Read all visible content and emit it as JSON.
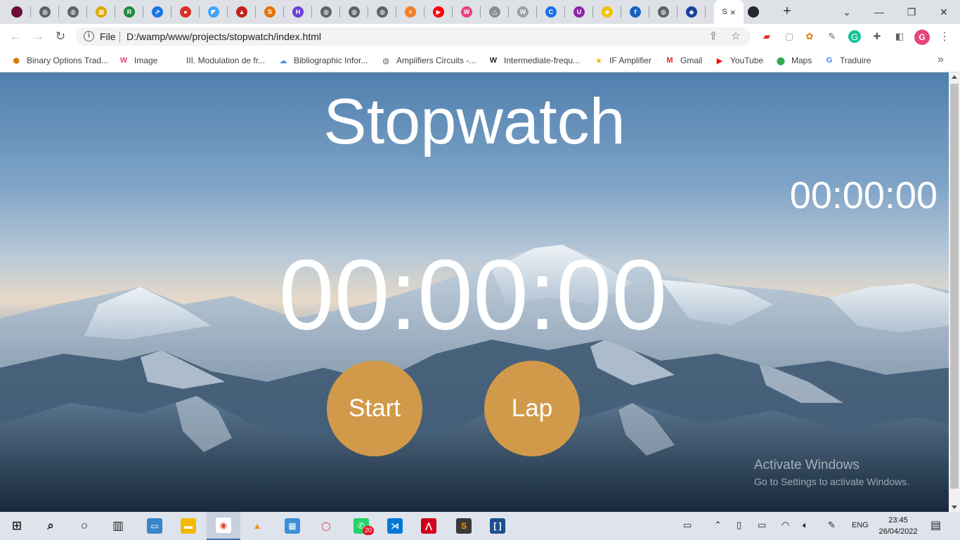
{
  "browser": {
    "tabs": [
      {
        "icon": "maroon-dot-icon",
        "color": "#6b0f3a"
      },
      {
        "icon": "globe-icon",
        "color": "#5f6368"
      },
      {
        "icon": "globe-icon",
        "color": "#5f6368"
      },
      {
        "icon": "grid-app-icon",
        "color": "#e0a800"
      },
      {
        "icon": "rr-icon",
        "color": "#1e8a3c"
      },
      {
        "icon": "link-icon",
        "color": "#1a73e8"
      },
      {
        "icon": "red-pin-icon",
        "color": "#d93025"
      },
      {
        "icon": "flutter-icon",
        "color": "#42a5f5"
      },
      {
        "icon": "tree-icon",
        "color": "#c5221f"
      },
      {
        "icon": "sr-icon",
        "color": "#e37400"
      },
      {
        "icon": "h-icon",
        "color": "#6a3fd6"
      },
      {
        "icon": "globe-icon",
        "color": "#5f6368"
      },
      {
        "icon": "globe-icon",
        "color": "#5f6368"
      },
      {
        "icon": "globe-icon",
        "color": "#5f6368"
      },
      {
        "icon": "stack-icon",
        "color": "#f48024"
      },
      {
        "icon": "youtube-icon",
        "color": "#ff0000"
      },
      {
        "icon": "w-icon",
        "color": "#e8437c"
      },
      {
        "icon": "triangle-icon",
        "color": "#8a8f96"
      },
      {
        "icon": "w-gray-icon",
        "color": "#9aa0a6"
      },
      {
        "icon": "c-icon",
        "color": "#1a73e8"
      },
      {
        "icon": "u-icon",
        "color": "#8e24aa"
      },
      {
        "icon": "face-icon",
        "color": "#f2c200"
      },
      {
        "icon": "fn-icon",
        "color": "#1565c0"
      },
      {
        "icon": "globe-icon",
        "color": "#5f6368"
      },
      {
        "icon": "shield-blue-icon",
        "color": "#1a3f9c"
      }
    ],
    "active_tab": {
      "label": "S",
      "close": "×"
    },
    "github_tab_icon": "github-icon",
    "new_tab": "+",
    "window_controls": {
      "dropdown": "⌄",
      "minimize": "—",
      "restore": "❐",
      "close": "✕"
    }
  },
  "toolbar": {
    "back": "←",
    "forward": "→",
    "reload": "↻",
    "scheme_label": "File",
    "url": "D:/wamp/www/projects/stopwatch/index.html",
    "profile_initial": "G"
  },
  "bookmarks": [
    {
      "label": "Binary Options Trad...",
      "icon": "cube-icon",
      "color": "#d97706"
    },
    {
      "label": "Image",
      "icon": "w-icon",
      "color": "#e8437c"
    },
    {
      "label": "III. Modulation de fr...",
      "icon": "blank-icon",
      "color": "#ffffff"
    },
    {
      "label": "Bibliographic Infor...",
      "icon": "cloud-icon",
      "color": "#4a90d9"
    },
    {
      "label": "Amplifiers Circuits -...",
      "icon": "globe-icon",
      "color": "#5f6368"
    },
    {
      "label": "Intermediate-frequ...",
      "icon": "wikipedia-icon",
      "color": "#222222"
    },
    {
      "label": "IF Amplifier",
      "icon": "star-icon",
      "color": "#f6b400"
    },
    {
      "label": "Gmail",
      "icon": "gmail-icon",
      "color": "#d93025"
    },
    {
      "label": "YouTube",
      "icon": "youtube-icon",
      "color": "#ff0000"
    },
    {
      "label": "Maps",
      "icon": "maps-icon",
      "color": "#34a853"
    },
    {
      "label": "Traduire",
      "icon": "translate-icon",
      "color": "#4285f4"
    }
  ],
  "bookmarks_more": "»",
  "stopwatch": {
    "title": "Stopwatch",
    "lap_time": "00:00:00",
    "main_time": "00:00:00",
    "start_label": "Start",
    "lap_label": "Lap",
    "button_color": "#d19a4a"
  },
  "watermark": {
    "line1": "Activate Windows",
    "line2": "Go to Settings to activate Windows."
  },
  "taskbar": {
    "apps": [
      {
        "name": "start-icon"
      },
      {
        "name": "search-icon"
      },
      {
        "name": "cortana-icon"
      },
      {
        "name": "task-view-icon"
      },
      {
        "name": "laptop-app-icon"
      },
      {
        "name": "file-explorer-icon"
      },
      {
        "name": "chrome-icon"
      },
      {
        "name": "vlc-icon"
      },
      {
        "name": "control-panel-icon"
      },
      {
        "name": "opera-icon"
      },
      {
        "name": "whatsapp-icon"
      },
      {
        "name": "vscode-icon"
      },
      {
        "name": "acrobat-icon"
      },
      {
        "name": "sublime-icon"
      },
      {
        "name": "brackets-icon"
      }
    ],
    "whatsapp_badge": "20",
    "language": "ENG",
    "time": "23:45",
    "date": "26/04/2022"
  }
}
